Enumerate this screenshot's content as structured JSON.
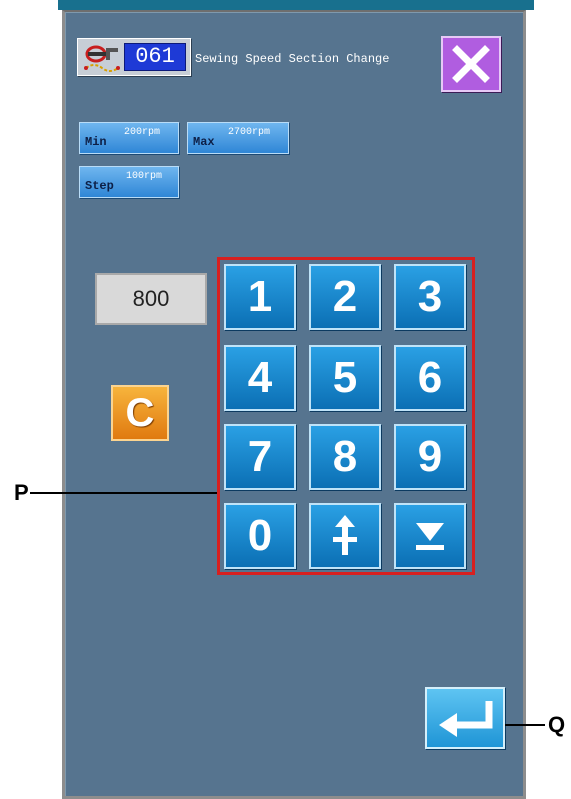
{
  "header": {
    "program_number": "061",
    "title": "Sewing Speed Section Change"
  },
  "range": {
    "min_label": "Min",
    "min_value": "200rpm",
    "max_label": "Max",
    "max_value": "2700rpm",
    "step_label": "Step",
    "step_value": "100rpm"
  },
  "value_display": "800",
  "clear_label": "C",
  "keypad": {
    "keys": [
      "1",
      "2",
      "3",
      "4",
      "5",
      "6",
      "7",
      "8",
      "9",
      "0"
    ]
  },
  "callouts": {
    "p": "P",
    "q": "Q"
  },
  "icons": {
    "header": "machine-icon",
    "close": "close-icon",
    "plus_minus": "plus-minus-icon",
    "down": "down-arrow-icon",
    "enter": "enter-icon"
  },
  "colors": {
    "panel": "#56748f",
    "key_blue": "#1a87cf",
    "clear_orange": "#f0951f",
    "close_purple": "#b05de0",
    "highlight_red": "#d72020"
  }
}
